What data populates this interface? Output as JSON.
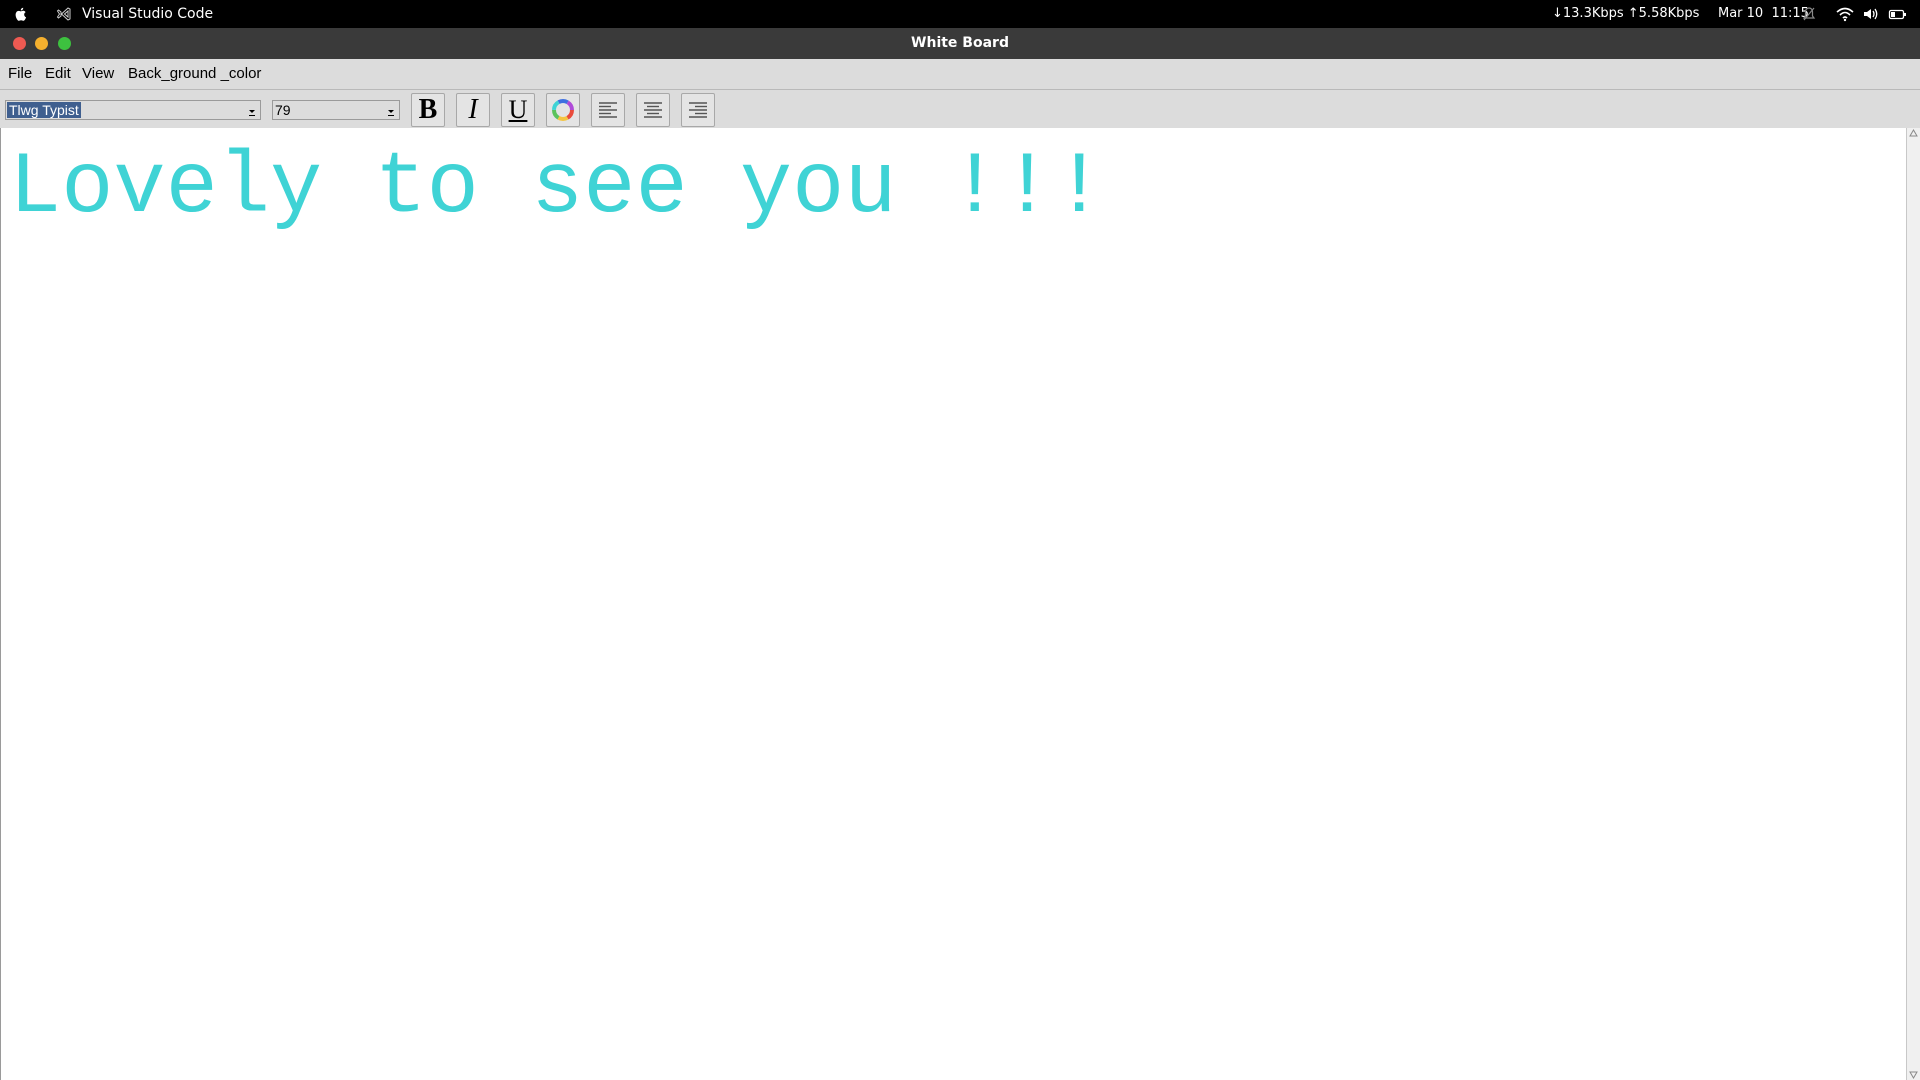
{
  "system_bar": {
    "app_name": "Visual Studio Code",
    "network": "↓13.3Kbps ↑5.58Kbps",
    "date": "Mar 10",
    "time": "11:15"
  },
  "window": {
    "title": "White Board"
  },
  "menu": {
    "items": [
      "File",
      "Edit",
      "View",
      "Back_ground _color"
    ]
  },
  "toolbar": {
    "font_family": "Tlwg Typist",
    "font_size": "79",
    "buttons": [
      "bold",
      "italic",
      "underline",
      "color-picker",
      "align-left",
      "align-center",
      "align-right"
    ],
    "bold_label": "B",
    "italic_label": "I",
    "underline_label": "U"
  },
  "editor": {
    "text": "Lovely to see you !!!",
    "text_color": "#3fd3d5",
    "background": "#ffffff"
  },
  "colors": {
    "selection": "#3f5f8f",
    "close": "#ee5a52",
    "minimize": "#f5b02e",
    "maximize": "#3dc13f"
  }
}
